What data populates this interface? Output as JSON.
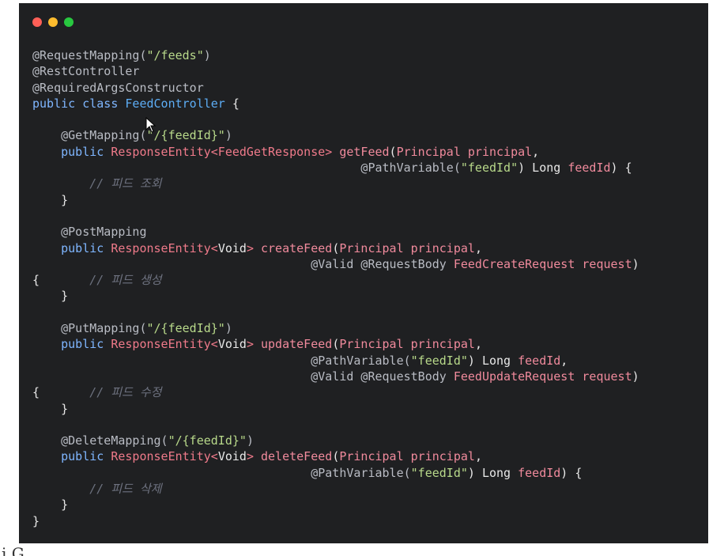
{
  "window": {
    "traffic_lights": [
      {
        "name": "close",
        "color": "#ff5f57"
      },
      {
        "name": "minimize",
        "color": "#febc2e"
      },
      {
        "name": "zoom",
        "color": "#28c840"
      }
    ]
  },
  "code": {
    "lines": [
      [
        {
          "t": "@RequestMapping(",
          "c": "anno"
        },
        {
          "t": "\"/feeds\"",
          "c": "str"
        },
        {
          "t": ")",
          "c": "anno"
        }
      ],
      [
        {
          "t": "@RestController",
          "c": "anno"
        }
      ],
      [
        {
          "t": "@RequiredArgsConstructor",
          "c": "anno"
        }
      ],
      [
        {
          "t": "public class ",
          "c": "kw"
        },
        {
          "t": "FeedController",
          "c": "cls"
        },
        {
          "t": " {",
          "c": "plain"
        }
      ],
      [
        {
          "t": "",
          "c": "plain"
        }
      ],
      [
        {
          "t": "    @GetMapping(",
          "c": "anno"
        },
        {
          "t": "\"/{feedId}\"",
          "c": "str"
        },
        {
          "t": ")",
          "c": "anno"
        }
      ],
      [
        {
          "t": "    public ",
          "c": "kw"
        },
        {
          "t": "ResponseEntity<FeedGetResponse> ",
          "c": "typ"
        },
        {
          "t": "getFeed",
          "c": "fn"
        },
        {
          "t": "(",
          "c": "plain"
        },
        {
          "t": "Principal principal",
          "c": "param"
        },
        {
          "t": ",",
          "c": "plain"
        }
      ],
      [
        {
          "t": "                                              @PathVariable(",
          "c": "anno"
        },
        {
          "t": "\"feedId\"",
          "c": "str"
        },
        {
          "t": ") Long ",
          "c": "plain"
        },
        {
          "t": "feedId",
          "c": "param"
        },
        {
          "t": ") {",
          "c": "plain"
        }
      ],
      [
        {
          "t": "        // 피드 조회",
          "c": "cmt"
        }
      ],
      [
        {
          "t": "    }",
          "c": "plain"
        }
      ],
      [
        {
          "t": "",
          "c": "plain"
        }
      ],
      [
        {
          "t": "    @PostMapping",
          "c": "anno"
        }
      ],
      [
        {
          "t": "    public ",
          "c": "kw"
        },
        {
          "t": "ResponseEntity<",
          "c": "typ"
        },
        {
          "t": "Void",
          "c": "plain"
        },
        {
          "t": "> ",
          "c": "typ"
        },
        {
          "t": "createFeed",
          "c": "fn"
        },
        {
          "t": "(",
          "c": "plain"
        },
        {
          "t": "Principal principal",
          "c": "param"
        },
        {
          "t": ",",
          "c": "plain"
        }
      ],
      [
        {
          "t": "                                       @Valid @RequestBody ",
          "c": "anno"
        },
        {
          "t": "FeedCreateRequest request",
          "c": "param"
        },
        {
          "t": ")",
          "c": "plain"
        }
      ],
      [
        {
          "t": "{       ",
          "c": "plain"
        },
        {
          "t": "// 피드 생성",
          "c": "cmt"
        }
      ],
      [
        {
          "t": "    }",
          "c": "plain"
        }
      ],
      [
        {
          "t": "",
          "c": "plain"
        }
      ],
      [
        {
          "t": "    @PutMapping(",
          "c": "anno"
        },
        {
          "t": "\"/{feedId}\"",
          "c": "str"
        },
        {
          "t": ")",
          "c": "anno"
        }
      ],
      [
        {
          "t": "    public ",
          "c": "kw"
        },
        {
          "t": "ResponseEntity<",
          "c": "typ"
        },
        {
          "t": "Void",
          "c": "plain"
        },
        {
          "t": "> ",
          "c": "typ"
        },
        {
          "t": "updateFeed",
          "c": "fn"
        },
        {
          "t": "(",
          "c": "plain"
        },
        {
          "t": "Principal principal",
          "c": "param"
        },
        {
          "t": ",",
          "c": "plain"
        }
      ],
      [
        {
          "t": "                                       @PathVariable(",
          "c": "anno"
        },
        {
          "t": "\"feedId\"",
          "c": "str"
        },
        {
          "t": ") Long ",
          "c": "plain"
        },
        {
          "t": "feedId",
          "c": "param"
        },
        {
          "t": ",",
          "c": "plain"
        }
      ],
      [
        {
          "t": "                                       @Valid @RequestBody ",
          "c": "anno"
        },
        {
          "t": "FeedUpdateRequest request",
          "c": "param"
        },
        {
          "t": ")",
          "c": "plain"
        }
      ],
      [
        {
          "t": "{       ",
          "c": "plain"
        },
        {
          "t": "// 피드 수정",
          "c": "cmt"
        }
      ],
      [
        {
          "t": "    }",
          "c": "plain"
        }
      ],
      [
        {
          "t": "",
          "c": "plain"
        }
      ],
      [
        {
          "t": "    @DeleteMapping(",
          "c": "anno"
        },
        {
          "t": "\"/{feedId}\"",
          "c": "str"
        },
        {
          "t": ")",
          "c": "anno"
        }
      ],
      [
        {
          "t": "    public ",
          "c": "kw"
        },
        {
          "t": "ResponseEntity<",
          "c": "typ"
        },
        {
          "t": "Void",
          "c": "plain"
        },
        {
          "t": "> ",
          "c": "typ"
        },
        {
          "t": "deleteFeed",
          "c": "fn"
        },
        {
          "t": "(",
          "c": "plain"
        },
        {
          "t": "Principal principal",
          "c": "param"
        },
        {
          "t": ",",
          "c": "plain"
        }
      ],
      [
        {
          "t": "                                       @PathVariable(",
          "c": "anno"
        },
        {
          "t": "\"feedId\"",
          "c": "str"
        },
        {
          "t": ") Long ",
          "c": "plain"
        },
        {
          "t": "feedId",
          "c": "param"
        },
        {
          "t": ") {",
          "c": "plain"
        }
      ],
      [
        {
          "t": "        // 피드 삭제",
          "c": "cmt"
        }
      ],
      [
        {
          "t": "    }",
          "c": "plain"
        }
      ],
      [
        {
          "t": "}",
          "c": "plain"
        }
      ]
    ]
  },
  "cursor_icon": "mouse-pointer-icon",
  "colors": {
    "background": "#1f2022",
    "annotation": "#b9bcc4",
    "string": "#b8d98a",
    "keyword": "#7fb6ff",
    "class_name": "#5dadf5",
    "type": "#ef7a8a",
    "comment": "#6e7280"
  },
  "footer": {
    "partial_text": "i    G"
  }
}
